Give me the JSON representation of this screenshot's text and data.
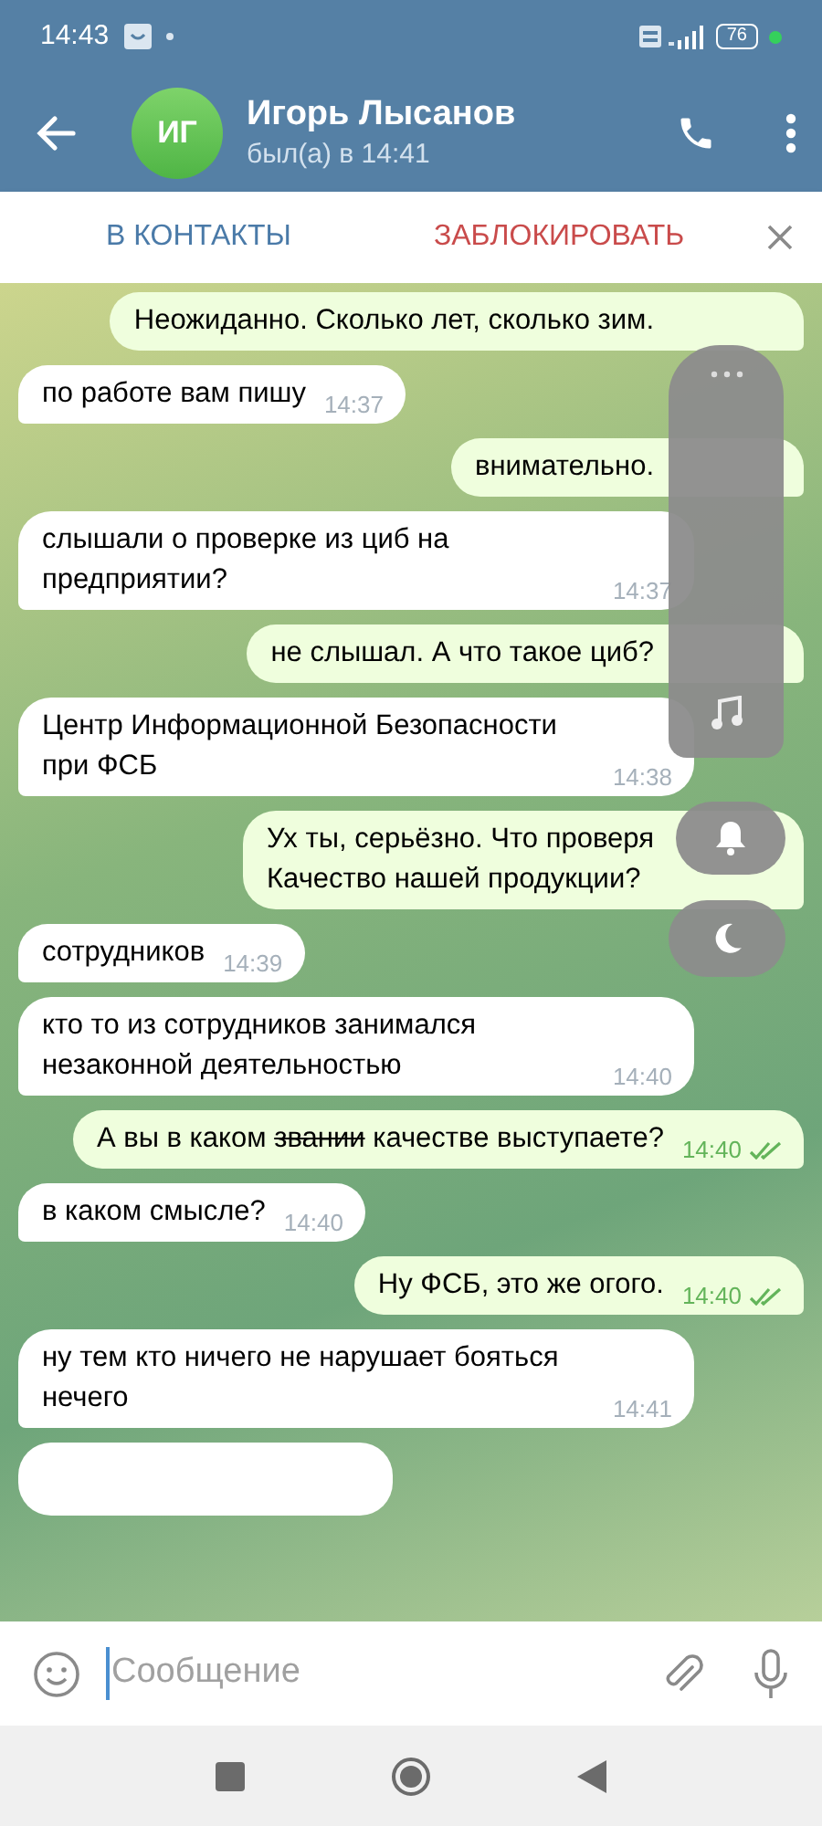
{
  "status_bar": {
    "time": "14:43",
    "battery": "76"
  },
  "header": {
    "avatar_initials": "ИГ",
    "name": "Игорь Лысанов",
    "last_seen": "был(а) в 14:41"
  },
  "action_bar": {
    "add_contact": "В КОНТАКТЫ",
    "block": "ЗАБЛОКИРОВАТЬ"
  },
  "messages": [
    {
      "kind": "outgoing",
      "segments": [
        {
          "text": "Неожиданно. Сколько лет, сколько зим."
        }
      ]
    },
    {
      "kind": "incoming",
      "segments": [
        {
          "text": "по работе вам пишу"
        }
      ],
      "time": "14:37"
    },
    {
      "kind": "outgoing",
      "segments": [
        {
          "text": "внимательно."
        }
      ]
    },
    {
      "kind": "incoming",
      "segments": [
        {
          "text": "слышали о проверке из циб на предприятии?"
        }
      ],
      "time": "14:37"
    },
    {
      "kind": "outgoing",
      "segments": [
        {
          "text": "не слышал. А что такое циб?"
        }
      ]
    },
    {
      "kind": "incoming",
      "segments": [
        {
          "text": "Центр Информационной Безопасности при ФСБ"
        }
      ],
      "time": "14:38"
    },
    {
      "kind": "outgoing",
      "segments": [
        {
          "text": "Ух ты, серьёзно. Что проверя"
        },
        {
          "text": "Качество нашей продукции?",
          "newline": true
        }
      ]
    },
    {
      "kind": "incoming",
      "segments": [
        {
          "text": "сотрудников"
        }
      ],
      "time": "14:39"
    },
    {
      "kind": "incoming",
      "segments": [
        {
          "text": "кто то из сотрудников занимался незаконной деятельностью"
        }
      ],
      "time": "14:40"
    },
    {
      "kind": "outgoing",
      "segments": [
        {
          "text": "А вы в каком "
        },
        {
          "text": "звании",
          "struck": true
        },
        {
          "text": " качестве выступаете?"
        }
      ],
      "time": "14:40",
      "read": true
    },
    {
      "kind": "incoming",
      "segments": [
        {
          "text": "в каком смысле?"
        }
      ],
      "time": "14:40"
    },
    {
      "kind": "outgoing",
      "segments": [
        {
          "text": "Ну ФСБ, это же огого."
        }
      ],
      "time": "14:40",
      "read": true
    },
    {
      "kind": "incoming",
      "segments": [
        {
          "text": "ну тем кто ничего не нарушает бояться нечего"
        }
      ],
      "time": "14:41"
    },
    {
      "kind": "cut"
    }
  ],
  "composer": {
    "placeholder": "Сообщение"
  }
}
